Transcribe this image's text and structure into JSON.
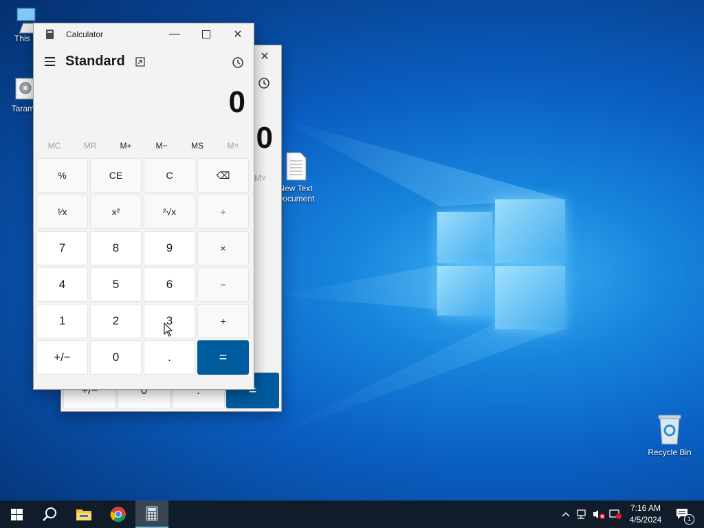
{
  "desktop": {
    "icons": [
      {
        "label": "This P"
      },
      {
        "label": "Taramal"
      },
      {
        "label": "New Text\nDocument"
      },
      {
        "label": "Recycle Bin"
      }
    ]
  },
  "back_window": {
    "display_value": "0",
    "memory_partial": "M˅",
    "bottom_keys": [
      "+/−",
      "0",
      ".",
      "="
    ]
  },
  "calculator": {
    "title": "Calculator",
    "mode": "Standard",
    "display_value": "0",
    "memory_buttons": [
      "MC",
      "MR",
      "M+",
      "M−",
      "MS",
      "M˅"
    ],
    "keys": [
      {
        "label": "%",
        "type": "fn",
        "name": "percent-button"
      },
      {
        "label": "CE",
        "type": "fn",
        "name": "clear-entry-button"
      },
      {
        "label": "C",
        "type": "fn",
        "name": "clear-button"
      },
      {
        "label": "⌫",
        "type": "fn",
        "name": "backspace-button"
      },
      {
        "label": "¹⁄x",
        "type": "fn",
        "name": "reciprocal-button"
      },
      {
        "label": "x²",
        "type": "fn",
        "name": "square-button"
      },
      {
        "label": "²√x",
        "type": "fn",
        "name": "square-root-button"
      },
      {
        "label": "÷",
        "type": "fn",
        "name": "divide-button"
      },
      {
        "label": "7",
        "type": "num",
        "name": "digit-7-button"
      },
      {
        "label": "8",
        "type": "num",
        "name": "digit-8-button"
      },
      {
        "label": "9",
        "type": "num",
        "name": "digit-9-button"
      },
      {
        "label": "×",
        "type": "fn",
        "name": "multiply-button"
      },
      {
        "label": "4",
        "type": "num",
        "name": "digit-4-button"
      },
      {
        "label": "5",
        "type": "num",
        "name": "digit-5-button"
      },
      {
        "label": "6",
        "type": "num",
        "name": "digit-6-button"
      },
      {
        "label": "−",
        "type": "fn",
        "name": "subtract-button"
      },
      {
        "label": "1",
        "type": "num",
        "name": "digit-1-button"
      },
      {
        "label": "2",
        "type": "num",
        "name": "digit-2-button"
      },
      {
        "label": "3",
        "type": "num",
        "name": "digit-3-button"
      },
      {
        "label": "+",
        "type": "fn",
        "name": "add-button"
      },
      {
        "label": "+/−",
        "type": "num",
        "name": "negate-button"
      },
      {
        "label": "0",
        "type": "num",
        "name": "digit-0-button"
      },
      {
        "label": ".",
        "type": "num",
        "name": "decimal-button"
      },
      {
        "label": "=",
        "type": "eq",
        "name": "equals-button"
      }
    ],
    "accent": "#005a9e"
  },
  "taskbar": {
    "clock_time": "7:16 AM",
    "clock_date": "4/5/2024",
    "notification_count": "1",
    "apps": [
      "start-icon",
      "search-icon",
      "file-explorer-icon",
      "chrome-icon",
      "calculator-icon"
    ]
  }
}
